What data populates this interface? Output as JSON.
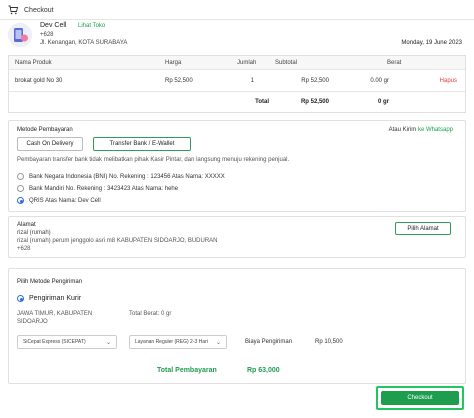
{
  "header": {
    "title": "Checkout"
  },
  "store": {
    "name": "Dev Cell",
    "visit_link": "Lihat Toko",
    "phone": "+628",
    "address": "Jl. Kenangan, KOTA SURABAYA",
    "date": "Monday, 19 June 2023"
  },
  "products": {
    "columns": [
      "Nama Produk",
      "Harga",
      "Jumlah",
      "Subtotal",
      "Berat"
    ],
    "rows": [
      {
        "name": "brokat gold No 30",
        "price": "Rp 52,500",
        "qty": "1",
        "subtotal": "Rp 52,500",
        "weight": "0.00 gr",
        "action": "Hapus"
      }
    ],
    "total_label": "Total",
    "total_value": "Rp 52,500",
    "total_weight": "0 gr"
  },
  "payment": {
    "title": "Metode Pembayaran",
    "cod_label": "Cash On Delivery",
    "transfer_label": "Transfer Bank / E-Wallet",
    "whatsapp_prefix": "Atau Kirim",
    "whatsapp_link": "ke Whatsapp",
    "note": "Pembayaran transfer bank tidak melibatkan pihak Kasir Pintar, dan langsung menuju rekening penjual.",
    "options": [
      {
        "label": "Bank Negara Indonesia (BNI) No. Rekening : 123456 Atas Nama: XXXXX",
        "selected": false
      },
      {
        "label": "Bank Mandiri No. Rekening : 3423423 Atas Nama: hehe",
        "selected": false
      },
      {
        "label": "QRIS Atas Nama: Dev Cell",
        "selected": true
      }
    ]
  },
  "address": {
    "title": "Alamat",
    "name": "rizal (rumah)",
    "line": "rizal (rumah) perum jenggolo asri m8 KABUPATEN SIDOARJO, BUDURAN",
    "phone": "+628",
    "button": "Pilih Alamat"
  },
  "shipping": {
    "title": "Pilih Metode Pengiriman",
    "option": "Pengiriman Kurir",
    "dest_line1": "JAWA TIMUR, KABUPATEN",
    "dest_line2": "SIDOARJO",
    "weight_label": "Total Berat: 0 gr",
    "courier": "SiCepat Express (SICEPAT)",
    "service": "Layanan Reguler (REG) 2-3 Hari",
    "cost_label": "Biaya Pengiriman",
    "cost_value": "Rp 10,500",
    "total_label": "Total Pembayaran",
    "total_value": "Rp 63,000"
  },
  "checkout_button": "Checkout",
  "colors": {
    "accent_green": "#1f9d4f",
    "highlight_green": "#22c55e",
    "delete_red": "#e23b3b",
    "radio_blue": "#2e6be6"
  }
}
